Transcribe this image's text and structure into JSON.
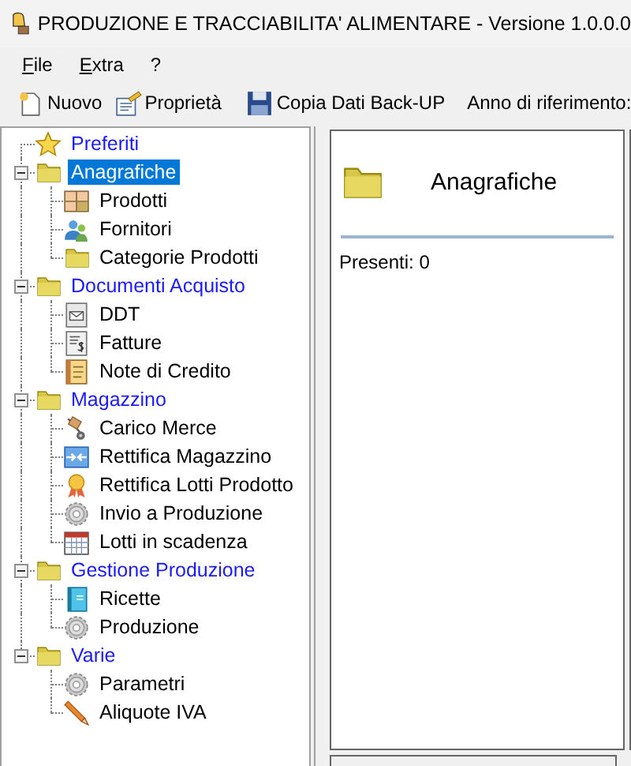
{
  "window": {
    "title": "PRODUZIONE E TRACCIABILITA' ALIMENTARE - Versione 1.0.0.0"
  },
  "menu": [
    {
      "label": "File"
    },
    {
      "label": "Extra"
    },
    {
      "label": "?"
    }
  ],
  "toolbar": [
    {
      "kind": "new",
      "label": "Nuovo"
    },
    {
      "kind": "properties",
      "label": "Proprietà"
    },
    {
      "kind": "separator"
    },
    {
      "kind": "backup",
      "label": "Copia Dati Back-UP"
    },
    {
      "kind": "separator"
    },
    {
      "kind": "label",
      "label": "Anno di riferimento:"
    }
  ],
  "tree": [
    {
      "label": "Preferiti",
      "kind": "star",
      "selected": false
    },
    {
      "label": "Anagrafiche",
      "kind": "folder",
      "expanded": true,
      "selected": true,
      "children": [
        {
          "label": "Prodotti",
          "kind": "grid",
          "selected": false
        },
        {
          "label": "Fornitori",
          "kind": "people",
          "selected": false
        },
        {
          "label": "Categorie Prodotti",
          "kind": "folder",
          "selected": false
        }
      ]
    },
    {
      "label": "Documenti Acquisto",
      "kind": "folder",
      "expanded": true,
      "selected": false,
      "children": [
        {
          "label": "DDT",
          "kind": "mail-doc",
          "selected": false
        },
        {
          "label": "Fatture",
          "kind": "dollar-doc",
          "selected": false
        },
        {
          "label": "Note di Credito",
          "kind": "note",
          "selected": false
        }
      ]
    },
    {
      "label": "Magazzino",
      "kind": "folder",
      "expanded": true,
      "selected": false,
      "children": [
        {
          "label": "Carico Merce",
          "kind": "truck",
          "selected": false
        },
        {
          "label": "Rettifica Magazzino",
          "kind": "arrows",
          "selected": false
        },
        {
          "label": "Rettifica Lotti Prodotto",
          "kind": "award",
          "selected": false
        },
        {
          "label": "Invio a Produzione",
          "kind": "gear",
          "selected": false
        },
        {
          "label": "Lotti in scadenza",
          "kind": "calendar",
          "selected": false
        }
      ]
    },
    {
      "label": "Gestione Produzione",
      "kind": "folder",
      "expanded": true,
      "selected": false,
      "children": [
        {
          "label": "Ricette",
          "kind": "book",
          "selected": false
        },
        {
          "label": "Produzione",
          "kind": "gear",
          "selected": false
        }
      ]
    },
    {
      "label": "Varie",
      "kind": "folder",
      "expanded": true,
      "selected": false,
      "children": [
        {
          "label": "Parametri",
          "kind": "gear",
          "selected": false
        },
        {
          "label": "Aliquote IVA",
          "kind": "pencil",
          "selected": false
        }
      ]
    }
  ],
  "detail": {
    "kind": "folder",
    "title": "Anagrafiche",
    "count": "Presenti: 0"
  }
}
